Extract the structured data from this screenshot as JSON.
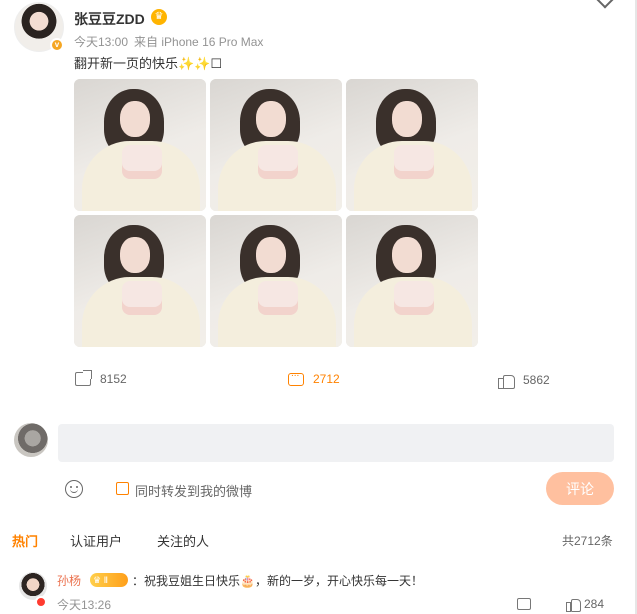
{
  "post": {
    "author": "张豆豆ZDD",
    "time": "今天13:00",
    "source": "来自 iPhone 16 Pro Max",
    "text": "翻开新一页的快乐✨✨☐",
    "photo_count": 6
  },
  "actions": {
    "share_count": "8152",
    "comment_count": "2712",
    "like_count": "5862"
  },
  "composer": {
    "input_value": "",
    "repost_label": "同时转发到我的微博",
    "submit_label": "评论"
  },
  "tabs": {
    "hot": "热门",
    "verified": "认证用户",
    "following": "关注的人",
    "total": "共2712条"
  },
  "comment": {
    "name": "孙杨",
    "badge": "Ⅱ",
    "text": "：祝我豆姐生日快乐🎂，新的一岁，开心快乐每一天！",
    "time": "今天13:26",
    "likes": "284"
  },
  "colors": {
    "accent": "#ff8200",
    "submit_bg": "#ffc09f",
    "input_bg": "#f0f1f3"
  }
}
